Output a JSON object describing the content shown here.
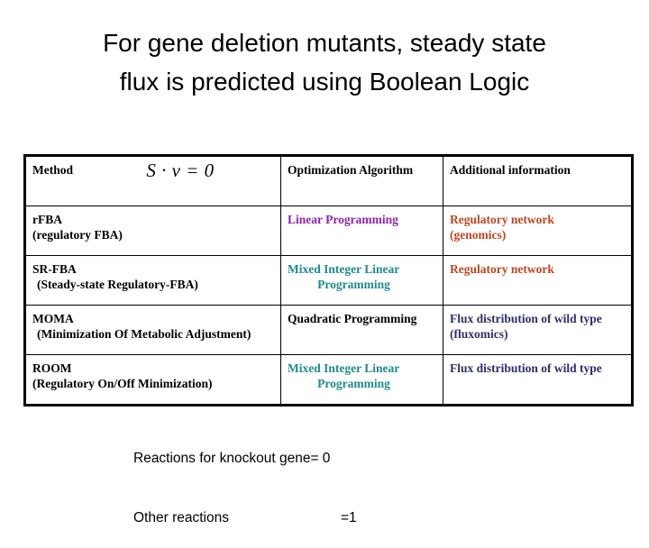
{
  "title": {
    "line1": "For gene deletion mutants, steady state",
    "line2": "flux is predicted using Boolean Logic"
  },
  "table": {
    "header": {
      "method": "Method",
      "equation": "S · v = 0",
      "equation_parts": {
        "s": "S",
        "dot": "·",
        "v": "v",
        "eq": "=",
        "zero": "0"
      },
      "optimization_algorithm": "Optimization  Algorithm",
      "additional_information": "Additional information"
    },
    "rows": [
      {
        "method_name": "rFBA",
        "method_sub": "(regulatory FBA)",
        "algorithm_line1": "Linear Programming",
        "algorithm_line2": "",
        "algorithm_color": "#8E24AA",
        "info_line1": "Regulatory network",
        "info_line2": "(genomics)",
        "info_color": "#C0451F"
      },
      {
        "method_name": "SR-FBA",
        "method_sub": "(Steady-state Regulatory-FBA)",
        "algorithm_line1": "Mixed Integer Linear",
        "algorithm_line2": "Programming",
        "algorithm_color": "#1E8B8B",
        "info_line1": "Regulatory network",
        "info_line2": "",
        "info_color": "#C0451F"
      },
      {
        "method_name": "MOMA",
        "method_sub": "(Minimization Of Metabolic Adjustment)",
        "algorithm_line1": "Quadratic Programming",
        "algorithm_line2": "",
        "algorithm_color": "#000000",
        "info_line1": "Flux distribution of wild type",
        "info_line2": "(fluxomics)",
        "info_color": "#2E2E6E"
      },
      {
        "method_name": "ROOM",
        "method_sub": "(Regulatory On/Off Minimization)",
        "algorithm_line1": "Mixed Integer Linear",
        "algorithm_line2": "Programming",
        "algorithm_color": "#1E8B8B",
        "info_line1": "Flux distribution of wild type",
        "info_line2": "",
        "info_color": "#2E2E6E"
      }
    ]
  },
  "caption": {
    "line1_label": "Reactions for knockout gene",
    "line1_value": "= 0",
    "line2_label": "Other reactions",
    "line2_value": "=1"
  }
}
